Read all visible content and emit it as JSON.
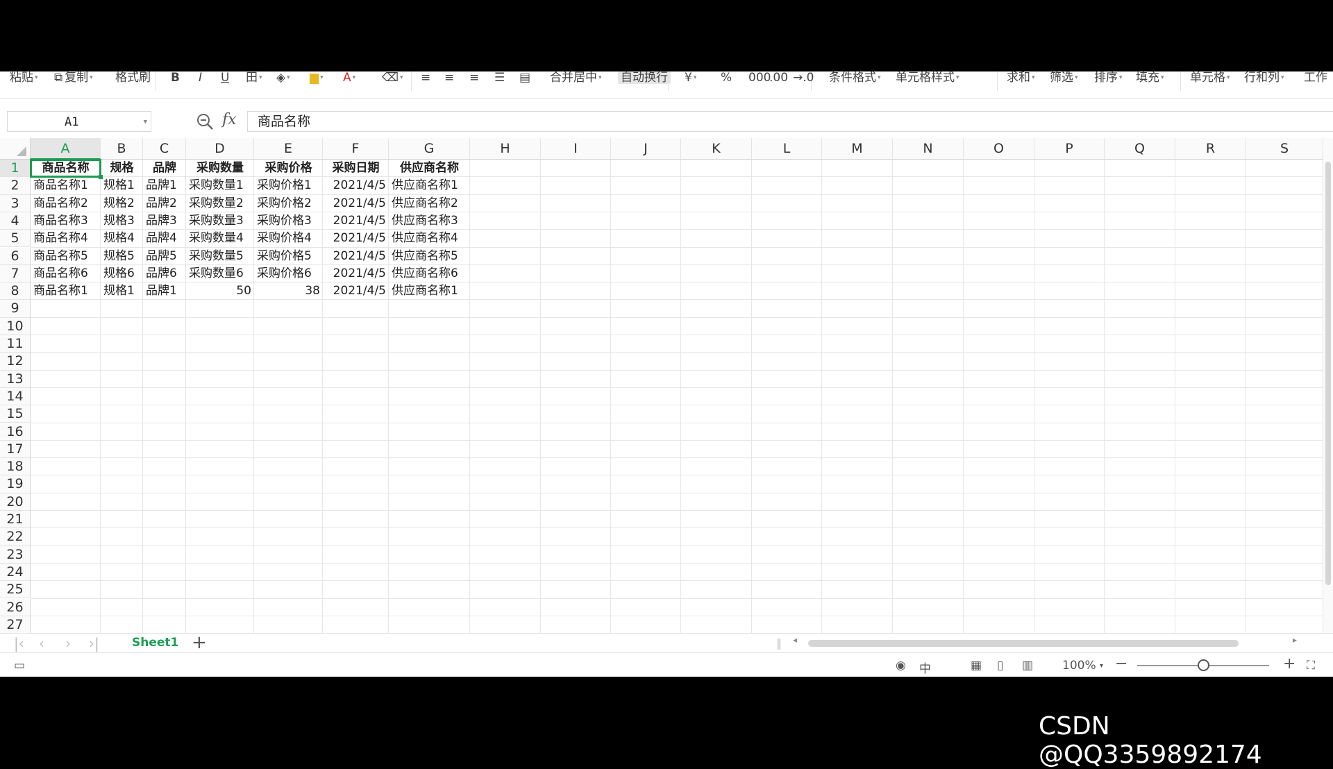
{
  "toolbar": {
    "items": [
      {
        "name": "paste-button",
        "label": "粘贴",
        "caret": true
      },
      {
        "name": "copy-button",
        "icon": "⧉",
        "label": "复制",
        "caret": true
      },
      {
        "name": "format-painter-button",
        "label": "格式刷"
      },
      {
        "name": "bold-button",
        "label": "B"
      },
      {
        "name": "italic-button",
        "label": "I"
      },
      {
        "name": "underline-button",
        "label": "U"
      },
      {
        "name": "border-button",
        "label": "田",
        "caret": true
      },
      {
        "name": "fill-style-button",
        "label": "◈",
        "caret": true
      },
      {
        "name": "fill-color-button",
        "label": "▆",
        "caret": true
      },
      {
        "name": "font-color-button",
        "label": "A",
        "caret": true
      },
      {
        "name": "clear-button",
        "label": "⌫",
        "caret": true
      },
      {
        "name": "align-left-button",
        "label": "≡"
      },
      {
        "name": "align-center-button",
        "label": "≡"
      },
      {
        "name": "align-right-button",
        "label": "≡"
      },
      {
        "name": "justify-button",
        "label": "☰"
      },
      {
        "name": "distributed-button",
        "label": "▤"
      },
      {
        "name": "merge-center-button",
        "label": "合并居中",
        "caret": true
      },
      {
        "name": "wrap-text-button",
        "label": "自动换行"
      },
      {
        "name": "currency-button",
        "label": "¥",
        "caret": true
      },
      {
        "name": "percent-button",
        "label": "%"
      },
      {
        "name": "thousands-button",
        "label": "000"
      },
      {
        "name": "increase-decimal-button",
        "label": ".00"
      },
      {
        "name": "decrease-decimal-button",
        "label": "→.0"
      },
      {
        "name": "conditional-format-button",
        "label": "条件格式",
        "caret": true
      },
      {
        "name": "cell-style-button",
        "label": "单元格样式",
        "caret": true
      },
      {
        "name": "sum-button",
        "label": "求和",
        "caret": true
      },
      {
        "name": "filter-button",
        "label": "筛选",
        "caret": true
      },
      {
        "name": "sort-button",
        "label": "排序",
        "caret": true
      },
      {
        "name": "fill-button",
        "label": "填充",
        "caret": true
      },
      {
        "name": "cell-button",
        "label": "单元格",
        "caret": true
      },
      {
        "name": "rows-cols-button",
        "label": "行和列",
        "caret": true
      },
      {
        "name": "worksheet-button",
        "label": "工作"
      }
    ]
  },
  "formula_bar": {
    "name_box": "A1",
    "fx_label": "fx",
    "formula": "商品名称"
  },
  "sheet": {
    "columns": [
      "A",
      "B",
      "C",
      "D",
      "E",
      "F",
      "G",
      "H",
      "I",
      "J",
      "K",
      "L",
      "M",
      "N",
      "O",
      "P",
      "Q",
      "R",
      "S"
    ],
    "visible_row_numbers": [
      "1",
      "2",
      "3",
      "4",
      "5",
      "6",
      "7",
      "8",
      "9",
      "10",
      "11",
      "12",
      "13",
      "14",
      "15",
      "16",
      "17",
      "18",
      "19",
      "20",
      "21",
      "22",
      "23",
      "24",
      "25",
      "26",
      "27"
    ],
    "selected_cell": "A1",
    "header_row": [
      "商品名称",
      "规格",
      "品牌",
      "采购数量",
      "采购价格",
      "采购日期",
      "供应商名称"
    ],
    "rows": [
      [
        "商品名称1",
        "规格1",
        "品牌1",
        "采购数量1",
        "采购价格1",
        "2021/4/5",
        "供应商名称1"
      ],
      [
        "商品名称2",
        "规格2",
        "品牌2",
        "采购数量2",
        "采购价格2",
        "2021/4/5",
        "供应商名称2"
      ],
      [
        "商品名称3",
        "规格3",
        "品牌3",
        "采购数量3",
        "采购价格3",
        "2021/4/5",
        "供应商名称3"
      ],
      [
        "商品名称4",
        "规格4",
        "品牌4",
        "采购数量4",
        "采购价格4",
        "2021/4/5",
        "供应商名称4"
      ],
      [
        "商品名称5",
        "规格5",
        "品牌5",
        "采购数量5",
        "采购价格5",
        "2021/4/5",
        "供应商名称5"
      ],
      [
        "商品名称6",
        "规格6",
        "品牌6",
        "采购数量6",
        "采购价格6",
        "2021/4/5",
        "供应商名称6"
      ],
      [
        "商品名称1",
        "规格1",
        "品牌1",
        "50",
        "38",
        "2021/4/5",
        "供应商名称1"
      ]
    ]
  },
  "tabs": {
    "sheets": [
      "Sheet1"
    ],
    "active": "Sheet1",
    "add_label": "+"
  },
  "status_bar": {
    "zoom": "100%",
    "zoom_level": 0.5
  },
  "watermark": "CSDN @QQ3359892174",
  "colors": {
    "accent": "#1a9e54",
    "selection": "#1f9a55"
  }
}
